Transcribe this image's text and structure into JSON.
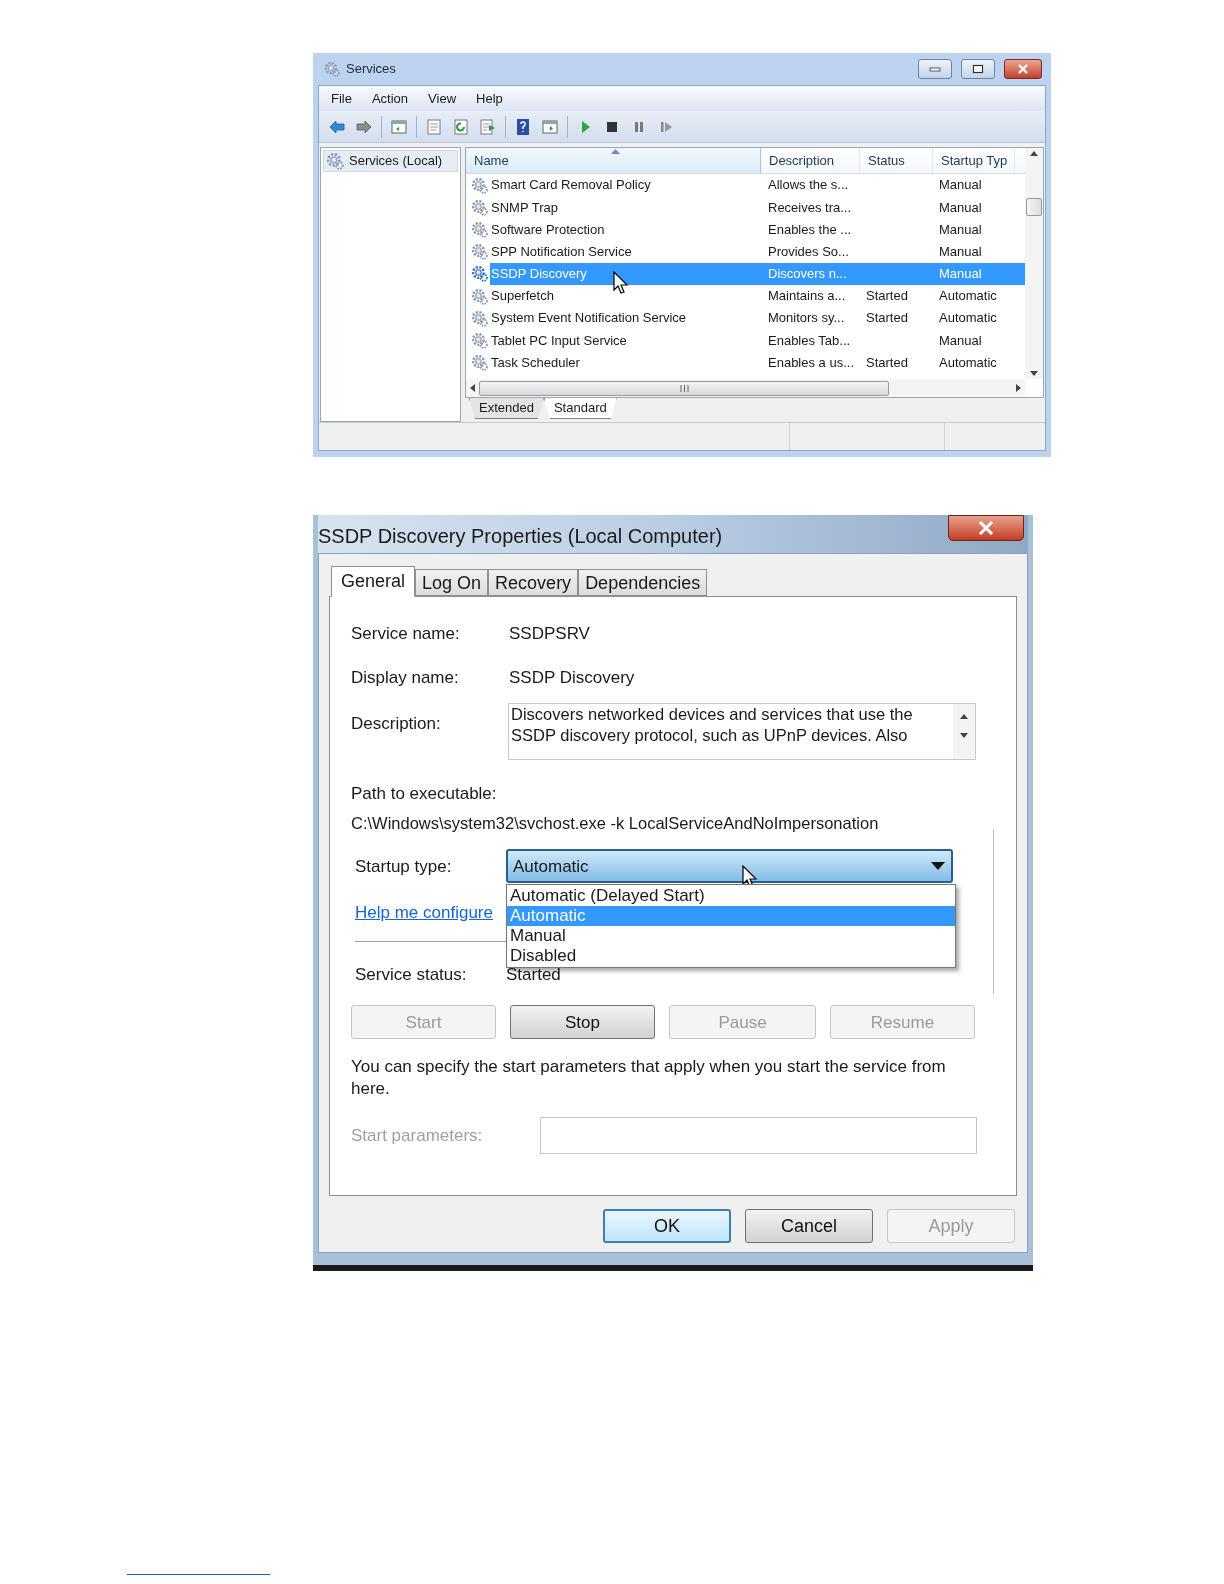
{
  "services_window": {
    "title": "Services",
    "menu": [
      "File",
      "Action",
      "View",
      "Help"
    ],
    "tree": [
      {
        "label": "Services (Local)",
        "selected": true
      }
    ],
    "columns": [
      "Name",
      "Description",
      "Status",
      "Startup Typ"
    ],
    "rows": [
      {
        "name": "Smart Card Removal Policy",
        "description": "Allows the s...",
        "startup": "Manual",
        "selected": false
      },
      {
        "name": "SNMP Trap",
        "description": "Receives tra...",
        "startup": "Manual",
        "selected": false
      },
      {
        "name": "Software Protection",
        "description": "Enables the ...",
        "startup": "Manual",
        "selected": false
      },
      {
        "name": "SPP Notification Service",
        "description": "Provides So...",
        "startup": "Manual",
        "selected": false
      },
      {
        "name": "SSDP Discovery",
        "description": "Discovers n...",
        "startup": "Manual",
        "selected": true
      },
      {
        "name": "Superfetch",
        "description": "Maintains a...",
        "status": "Started",
        "startup": "Automatic",
        "selected": false
      },
      {
        "name": "System Event Notification Service",
        "description": "Monitors sy...",
        "status": "Started",
        "startup": "Automatic",
        "selected": false
      },
      {
        "name": "Tablet PC Input Service",
        "description": "Enables Tab...",
        "startup": "Manual",
        "selected": false
      },
      {
        "name": "Task Scheduler",
        "description": "Enables a us...",
        "status": "Started",
        "startup": "Automatic",
        "selected": false
      }
    ],
    "view_tabs": [
      {
        "label": "Extended",
        "selected": false
      },
      {
        "label": "Standard",
        "selected": true
      }
    ]
  },
  "properties_dialog": {
    "title": "SSDP Discovery Properties (Local Computer)",
    "tabs": [
      {
        "label": "General",
        "selected": true
      },
      {
        "label": "Log On",
        "selected": false
      },
      {
        "label": "Recovery",
        "selected": false
      },
      {
        "label": "Dependencies",
        "selected": false
      }
    ],
    "service_name": {
      "label": "Service name:",
      "value": "SSDPSRV"
    },
    "display_name": {
      "label": "Display name:",
      "value": "SSDP Discovery"
    },
    "description": {
      "label": "Description:",
      "value": "Discovers networked devices and services that use the SSDP discovery protocol, such as UPnP devices. Also"
    },
    "path": {
      "label": "Path to executable:",
      "value": "C:\\Windows\\system32\\svchost.exe -k LocalServiceAndNoImpersonation"
    },
    "startup_type": {
      "label": "Startup type:",
      "value": "Automatic",
      "options": [
        {
          "label": "Automatic (Delayed Start)",
          "selected": false
        },
        {
          "label": "Automatic",
          "selected": true
        },
        {
          "label": "Manual",
          "selected": false
        },
        {
          "label": "Disabled",
          "selected": false
        }
      ]
    },
    "help_link": "Help me configure",
    "service_status": {
      "label": "Service status:",
      "value": "Started"
    },
    "control_buttons": [
      {
        "label": "Start",
        "disabled": true
      },
      {
        "label": "Stop",
        "disabled": false
      },
      {
        "label": "Pause",
        "disabled": true
      },
      {
        "label": "Resume",
        "disabled": true
      }
    ],
    "note": "You can specify the start parameters that apply when you start the service from here.",
    "start_parameters": {
      "label": "Start parameters:",
      "disabled": true
    },
    "footer_buttons": [
      {
        "label": "OK",
        "default": true,
        "disabled": false
      },
      {
        "label": "Cancel",
        "default": false,
        "disabled": false
      },
      {
        "label": "Apply",
        "default": false,
        "disabled": true
      }
    ]
  }
}
